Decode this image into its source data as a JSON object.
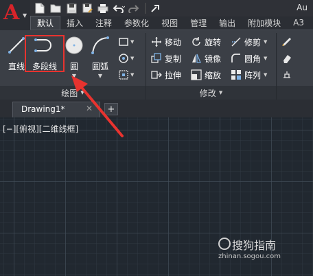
{
  "app": {
    "logo_letter": "A",
    "title_fragment": "Au"
  },
  "quick_access": {
    "icons": [
      "new-file-icon",
      "open-file-icon",
      "save-icon",
      "save-as-icon",
      "print-icon",
      "undo-icon",
      "redo-icon",
      "share-icon"
    ]
  },
  "ribbon_tabs": [
    {
      "label": "默认",
      "active": true
    },
    {
      "label": "插入",
      "active": false
    },
    {
      "label": "注释",
      "active": false
    },
    {
      "label": "参数化",
      "active": false
    },
    {
      "label": "视图",
      "active": false
    },
    {
      "label": "管理",
      "active": false
    },
    {
      "label": "输出",
      "active": false
    },
    {
      "label": "附加模块",
      "active": false
    },
    {
      "label": "A3",
      "active": false
    }
  ],
  "draw_panel": {
    "title": "绘图",
    "line_label": "直线",
    "polyline_label": "多段线",
    "circle_label": "圆",
    "arc_label": "圆弧"
  },
  "modify_panel": {
    "title": "修改",
    "items": [
      {
        "label": "移动",
        "icon": "move-icon"
      },
      {
        "label": "旋转",
        "icon": "rotate-icon"
      },
      {
        "label": "修剪",
        "icon": "trim-icon"
      },
      {
        "label": "复制",
        "icon": "copy-icon"
      },
      {
        "label": "镜像",
        "icon": "mirror-icon"
      },
      {
        "label": "圆角",
        "icon": "fillet-icon"
      },
      {
        "label": "拉伸",
        "icon": "stretch-icon"
      },
      {
        "label": "缩放",
        "icon": "scale-icon"
      },
      {
        "label": "阵列",
        "icon": "array-icon"
      }
    ]
  },
  "document_tabs": {
    "active_name": "Drawing1*",
    "close_glyph": "✕",
    "add_glyph": "+"
  },
  "canvas": {
    "viewport_label": "[−][俯视][二维线框]"
  },
  "watermark": {
    "main": "搜狗指南",
    "sub": "zhinan.sogou.com"
  },
  "colors": {
    "accent_red": "#e8332f",
    "canvas_bg": "#212830",
    "ribbon_bg": "#3b3f46"
  }
}
